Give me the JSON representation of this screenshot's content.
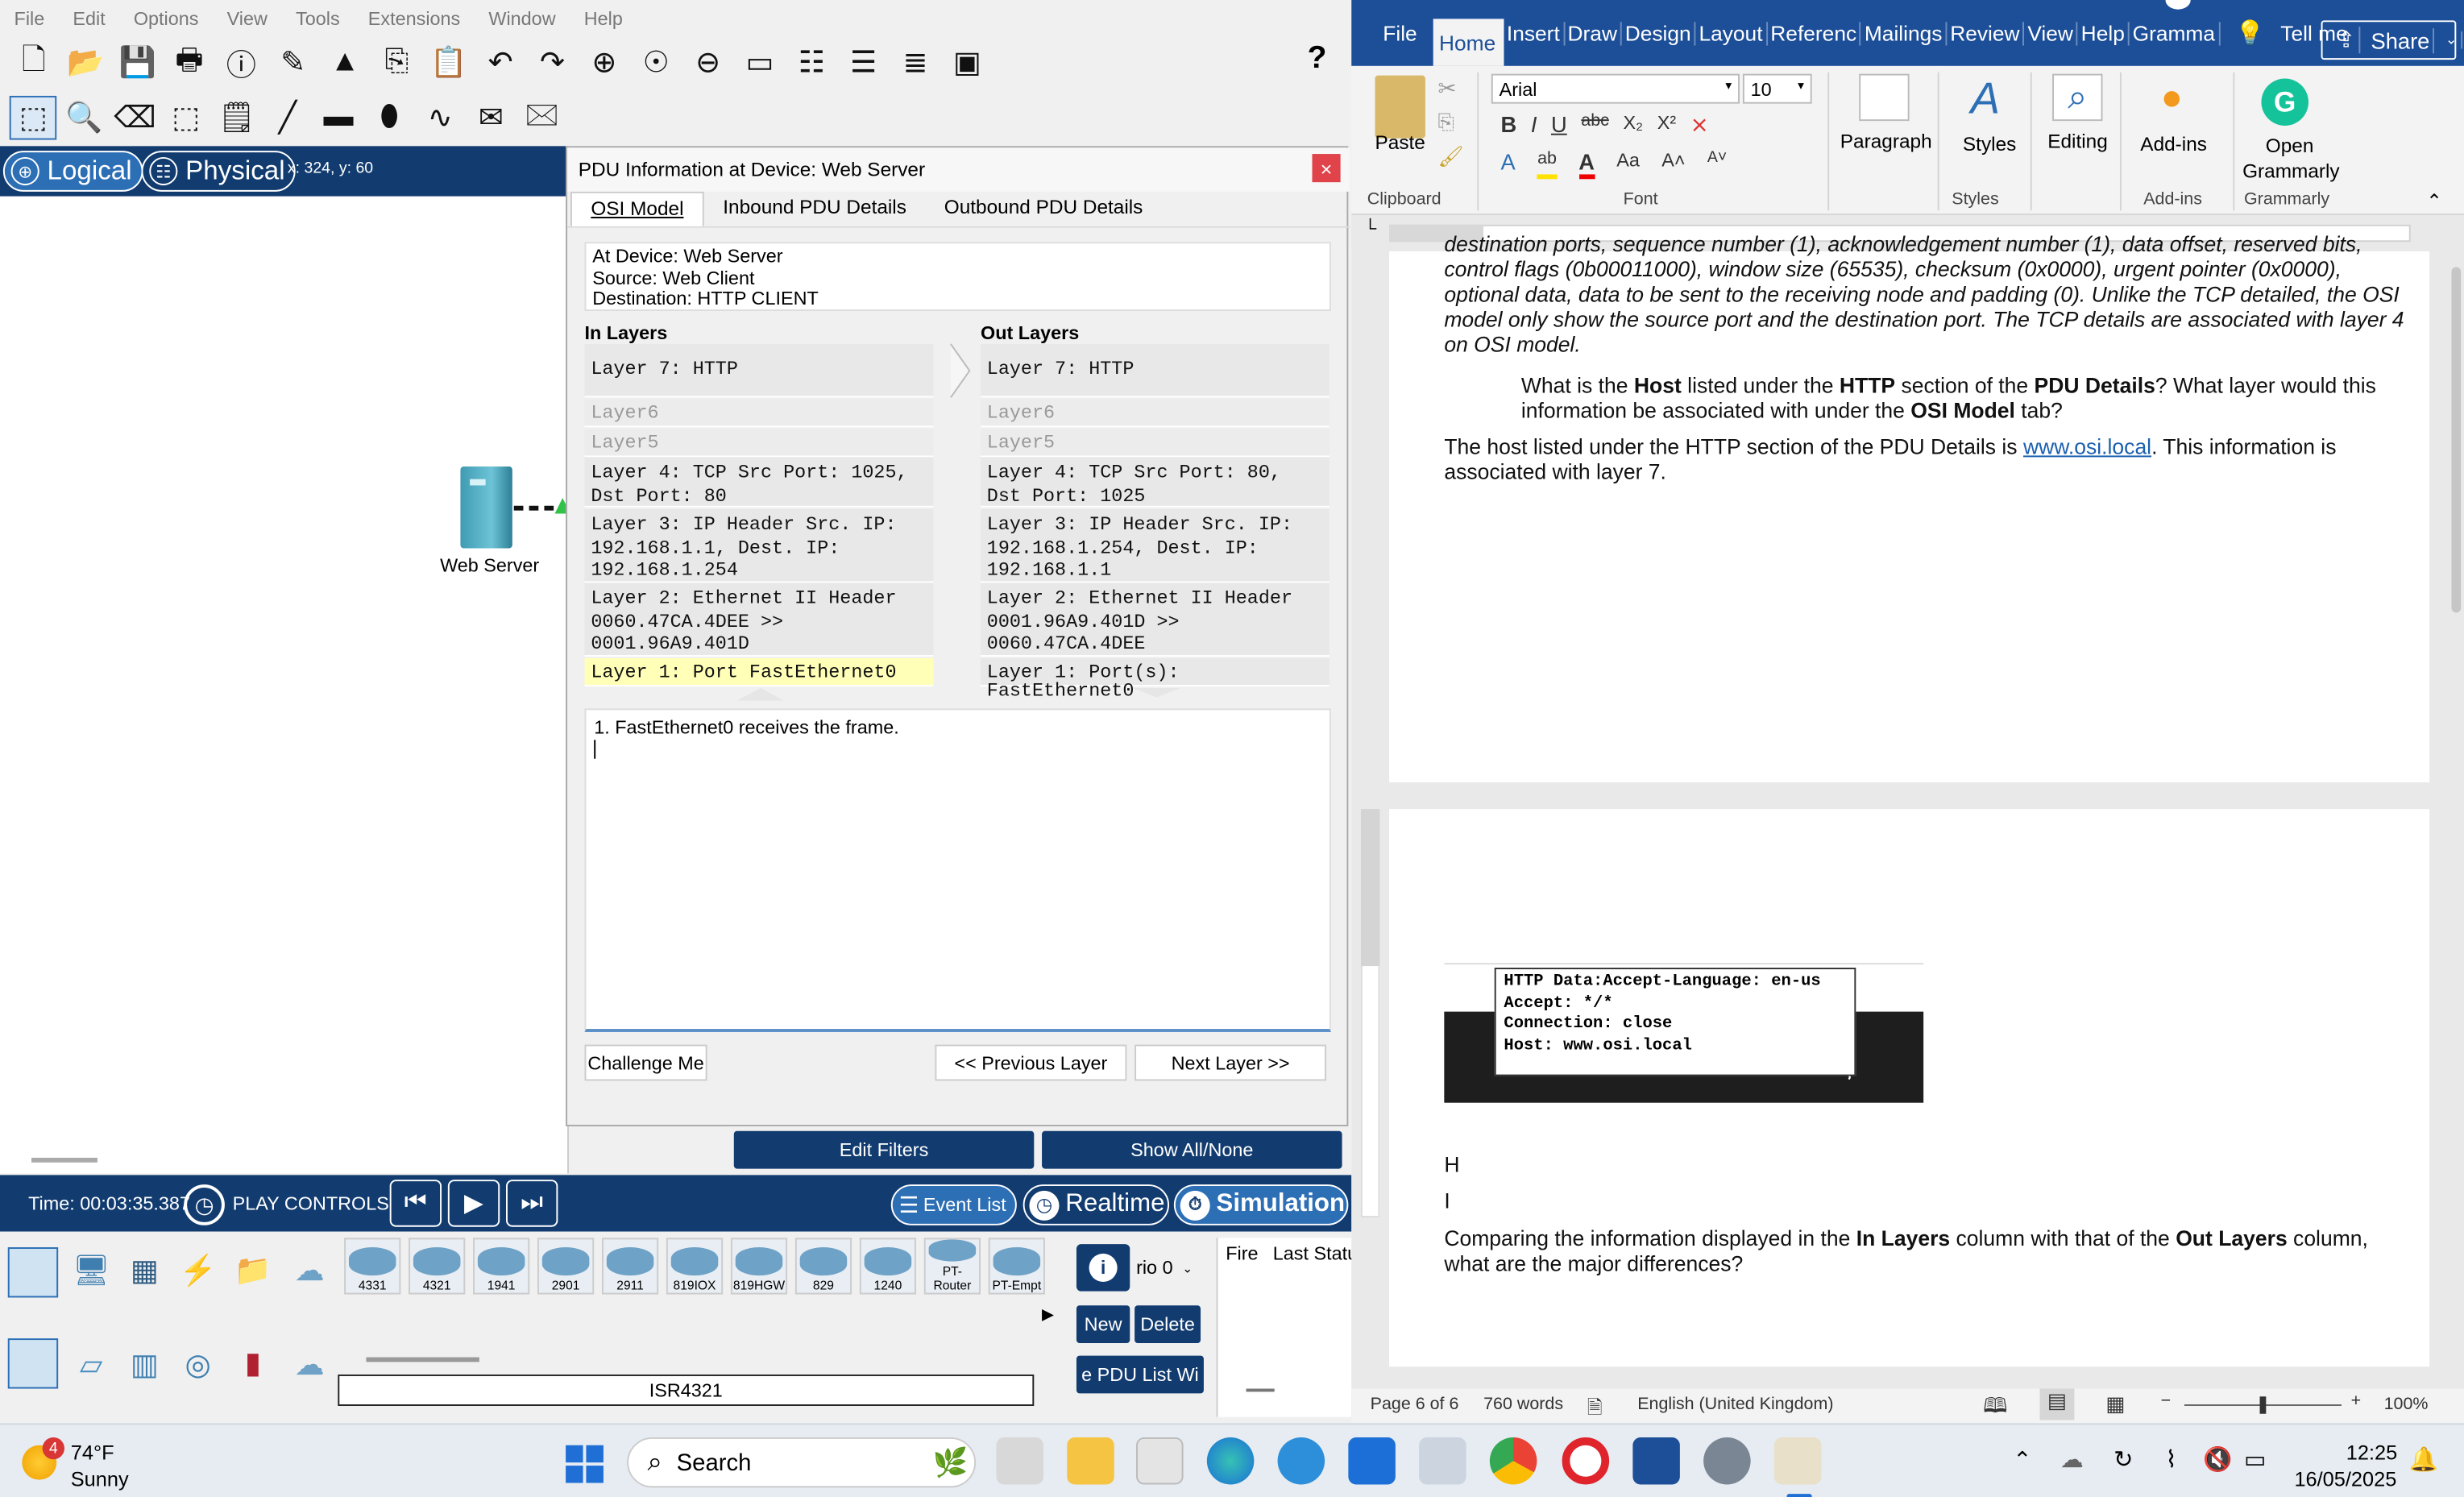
{
  "pt": {
    "menu": [
      "File",
      "Edit",
      "Options",
      "View",
      "Tools",
      "Extensions",
      "Window",
      "Help"
    ],
    "help_icon": "?",
    "view_logical": "Logical",
    "view_physical": "Physical",
    "coords": "x: 324, y: 60",
    "device_label": "Web Server",
    "time_label": "Time: 00:03:35.387",
    "play_controls": "PLAY CONTROLS:",
    "event_list": "Event List",
    "realtime": "Realtime",
    "simulation": "Simulation",
    "edit_filters": "Edit Filters",
    "show_all": "Show All/None",
    "devices": [
      "4331",
      "4321",
      "1941",
      "2901",
      "2911",
      "819IOX",
      "819HGW",
      "829",
      "1240",
      "PT-Router",
      "PT-Empt"
    ],
    "selected_device": "ISR4321",
    "scenario": "rio 0",
    "new_btn": "New",
    "delete_btn": "Delete",
    "pdu_list_btn": "e PDU List Wi",
    "col_fire": "Fire",
    "col_last_status": "Last Statu"
  },
  "dlg": {
    "title": "PDU Information at Device: Web Server",
    "close": "×",
    "tabs": [
      "OSI Model",
      "Inbound PDU Details",
      "Outbound PDU Details"
    ],
    "info": [
      "At Device: Web Server",
      "Source: Web Client",
      "Destination: HTTP CLIENT"
    ],
    "in_header": "In Layers",
    "out_header": "Out Layers",
    "in_layers": [
      "Layer 7: HTTP",
      "Layer6",
      "Layer5",
      "Layer 4: TCP Src Port: 1025, Dst Port: 80",
      "Layer 3: IP Header Src. IP: 192.168.1.1, Dest. IP: 192.168.1.254",
      "Layer 2: Ethernet II Header 0060.47CA.4DEE >> 0001.96A9.401D",
      "Layer 1: Port FastEthernet0"
    ],
    "out_layers": [
      "Layer 7: HTTP",
      "Layer6",
      "Layer5",
      "Layer 4: TCP Src Port: 80, Dst Port: 1025",
      "Layer 3: IP Header Src. IP: 192.168.1.254, Dest. IP: 192.168.1.1",
      "Layer 2: Ethernet II Header 0001.96A9.401D >> 0060.47CA.4DEE",
      "Layer 1: Port(s): FastEthernet0"
    ],
    "description": "1. FastEthernet0 receives the frame.",
    "challenge_btn": "Challenge Me",
    "prev_btn": "<< Previous Layer",
    "next_btn": "Next Layer >>"
  },
  "word": {
    "tabs": [
      "File",
      "Home",
      "Insert",
      "Draw",
      "Design",
      "Layout",
      "Referenc",
      "Mailings",
      "Review",
      "View",
      "Help",
      "Gramma"
    ],
    "tell_me": "Tell me",
    "share": "Share",
    "paste": "Paste",
    "font_name": "Arial",
    "font_size": "10",
    "paragraph": "Paragraph",
    "styles": "Styles",
    "editing": "Editing",
    "addins": "Add-ins",
    "grammarly": "Open Grammarly",
    "groups": [
      "Clipboard",
      "Font",
      "Styles",
      "Add-ins",
      "Grammarly"
    ],
    "p1_italic": "destination ports, sequence number (1), acknowledgement number (1), data offset, reserved bits, control flags (0b00011000), window size (65535), checksum (0x0000), urgent pointer (0x0000), optional data, data to be sent to the receiving node and padding (0). Unlike the TCP detailed, the OSI model only show the source port and the destination port. The TCP details are associated with layer 4 on OSI model.",
    "q_parts": [
      "What is the ",
      "Host",
      " listed under the ",
      "HTTP",
      " section of the ",
      "PDU Details",
      "? What layer would this information be associated with under the ",
      "OSI Model",
      " tab?"
    ],
    "a_parts": [
      "The host listed under the HTTP section of the PDU Details is ",
      "www.osi.local",
      ". This information is associated with layer 7."
    ],
    "popup_lines": [
      "HTTP Data:Accept-Language: en-us",
      "Accept: */*",
      "Connection: close",
      "Host: www.osi.local"
    ],
    "h_letter": "H",
    "i_letter": "I",
    "q2_parts": [
      "Comparing the information displayed in the ",
      "In Layers",
      " column with that of the ",
      "Out Layers",
      " column, what are the major differences?"
    ],
    "page_info": "Page 6 of 6",
    "words": "760 words",
    "language": "English (United Kingdom)",
    "zoom": "100%"
  },
  "taskbar": {
    "temp": "74°F",
    "weather": "Sunny",
    "weather_badge": "4",
    "search": "Search",
    "time": "12:25",
    "date": "16/05/2025"
  }
}
